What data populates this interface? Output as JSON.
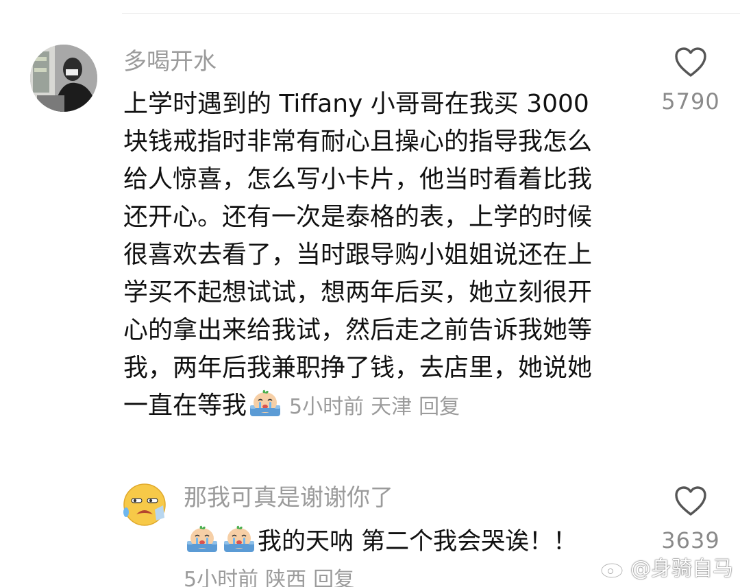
{
  "comment": {
    "username": "多喝开水",
    "lines": [
      "上学时遇到的 Tiffany 小哥哥在我买 3000",
      "块钱戒指时非常有耐心且操心的指导我怎么",
      "给人惊喜，怎么写小卡片，他当时看着比我",
      "还开心。还有一次是泰格的表，上学的时候",
      "很喜欢去看了，当时跟导购小姐姐说还在上",
      "学买不起想试试，想两年后买，她立刻很开",
      "心的拿出来给我试，然后走之前告诉我她等",
      "我，两年后我兼职挣了钱，去店里，她说她"
    ],
    "last_line": "一直在等我",
    "emoji": "crying-emoji",
    "time": "5小时前",
    "location": "天津",
    "reply_label": "回复",
    "like_count": "5790",
    "like_icon": "heart-outline-icon"
  },
  "reply": {
    "username": "那我可真是谢谢你了",
    "avatar_emoji": "weary-emoji",
    "emojis": [
      "crying-emoji",
      "crying-emoji"
    ],
    "text": "我的天呐 第二个我会哭诶！！",
    "time": "5小时前",
    "location": "陕西",
    "reply_label": "回复",
    "like_count": "3639",
    "like_icon": "heart-outline-icon"
  },
  "watermark": {
    "text": "@身骑自马",
    "icon": "weibo-logo-icon"
  },
  "colors": {
    "text": "#111111",
    "muted": "#9b9b9b",
    "count": "#8a8a8a",
    "background": "#ffffff"
  }
}
